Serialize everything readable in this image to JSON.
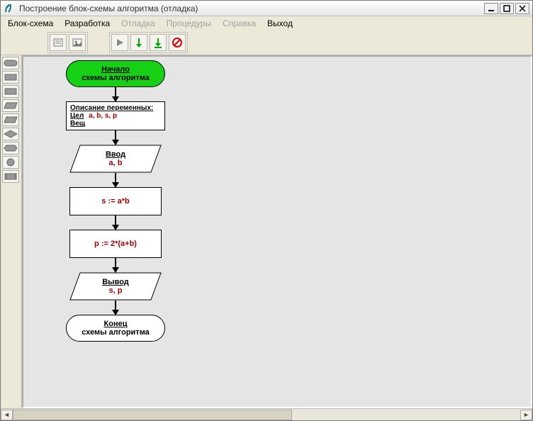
{
  "window": {
    "title": "Построение блок-схемы алгоритма (отладка)"
  },
  "menu": {
    "scheme": "Блок-схема",
    "develop": "Разработка",
    "debug": "Отладка",
    "procedures": "Процедуры",
    "help": "Справка",
    "exit": "Выход"
  },
  "flowchart": {
    "start": {
      "line1": "Начало",
      "line2": "схемы алгоритма"
    },
    "decl": {
      "header": "Описание переменных:",
      "type_int": "Цел",
      "int_vars": "a, b, s, p",
      "type_real": "Вещ"
    },
    "input": {
      "label": "Ввод",
      "vars": "a, b"
    },
    "proc1": "s := a*b",
    "proc2": "p := 2*(a+b)",
    "output": {
      "label": "Вывод",
      "vars": "s, p"
    },
    "end": {
      "line1": "Конец",
      "line2": "схемы алгоритма"
    }
  }
}
